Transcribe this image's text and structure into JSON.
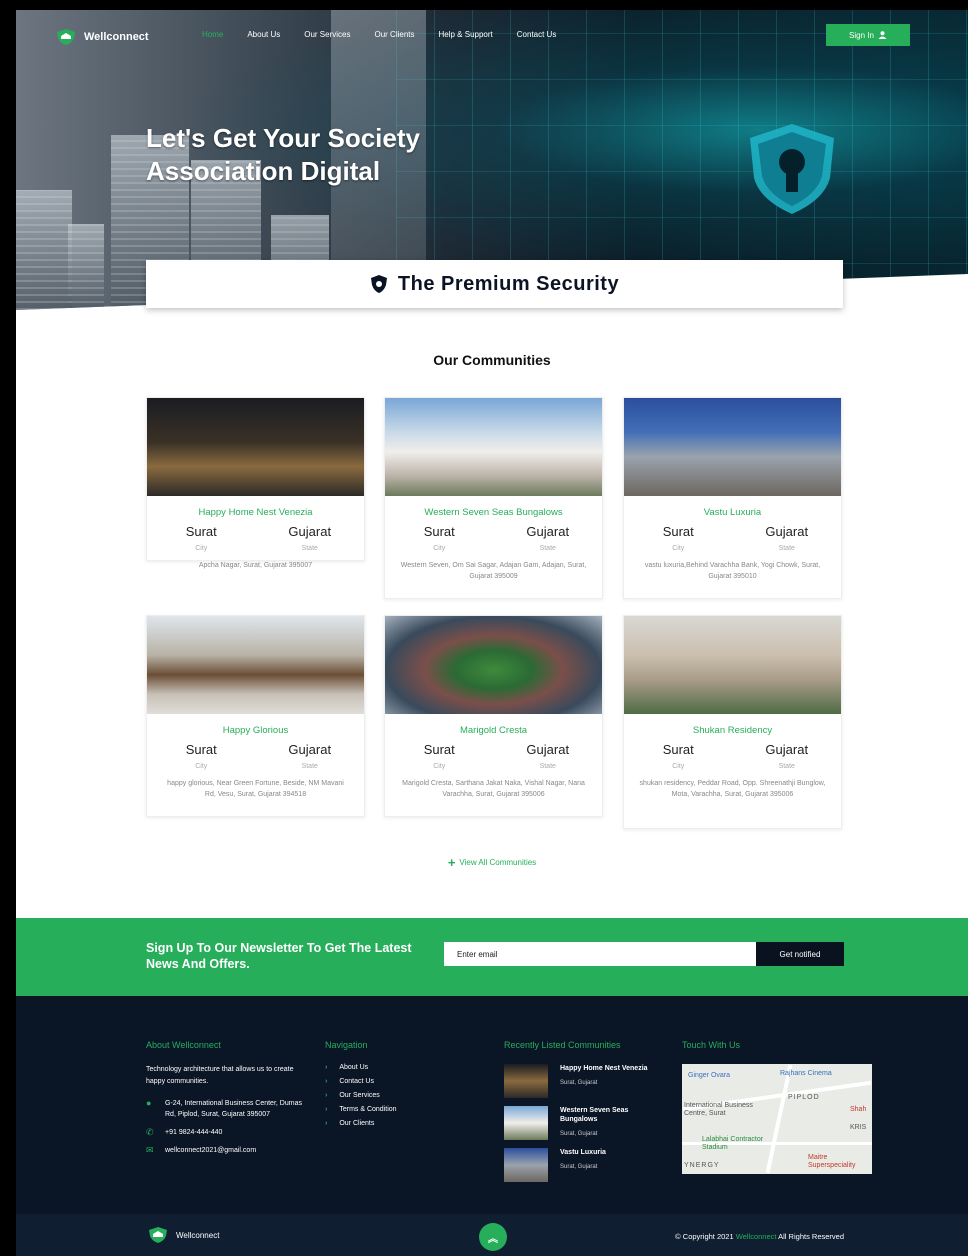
{
  "brand": {
    "name": "Wellconnect"
  },
  "nav": {
    "items": [
      {
        "label": "Home",
        "active": true
      },
      {
        "label": "About Us"
      },
      {
        "label": "Our Services"
      },
      {
        "label": "Our Clients"
      },
      {
        "label": "Help & Support"
      },
      {
        "label": "Contact Us"
      }
    ],
    "signin_label": "Sign In"
  },
  "hero": {
    "title_line1": "Let's Get Your Society",
    "title_line2": "Association Digital",
    "premium": "The Premium Security"
  },
  "communities": {
    "title": "Our Communities",
    "cards": [
      {
        "name": "Happy Home Nest Venezia",
        "city": "Surat",
        "state": "Gujarat",
        "city_label": "City",
        "state_label": "State",
        "address": "Apcha Nagar, Surat, Gujarat 395007"
      },
      {
        "name": "Western Seven Seas Bungalows",
        "city": "Surat",
        "state": "Gujarat",
        "city_label": "City",
        "state_label": "State",
        "address": "Western Seven, Om Sai Sagar, Adajan Gam, Adajan, Surat, Gujarat 395009"
      },
      {
        "name": "Vastu Luxuria",
        "city": "Surat",
        "state": "Gujarat",
        "city_label": "City",
        "state_label": "State",
        "address": "vastu luxuria,Behind Varachha Bank, Yogi Chowk, Surat, Gujarat 395010"
      },
      {
        "name": "Happy Glorious",
        "city": "Surat",
        "state": "Gujarat",
        "city_label": "City",
        "state_label": "State",
        "address": "happy glorious, Near Green Fortune, Beside, NM Mavani Rd, Vesu, Surat, Gujarat 394518"
      },
      {
        "name": "Marigold Cresta",
        "city": "Surat",
        "state": "Gujarat",
        "city_label": "City",
        "state_label": "State",
        "address": "Marigold Cresta, Sarthana Jakat Naka, Vishal Nagar, Nana Varachha, Surat, Gujarat 395006"
      },
      {
        "name": "Shukan Residency",
        "city": "Surat",
        "state": "Gujarat",
        "city_label": "City",
        "state_label": "State",
        "address": "shukan residency, Peddar Road, Opp. Shreenathji Bunglow, Mota, Varachha, Surat, Gujarat 395006"
      }
    ],
    "view_all": "View All Communities"
  },
  "newsletter": {
    "text": "Sign Up To Our Newsletter To Get The Latest News And Offers.",
    "placeholder": "Enter email",
    "button": "Get notified"
  },
  "footer": {
    "about": {
      "heading": "About Wellconnect",
      "text": "Technology architecture that allows us to create happy communities.",
      "address": "G-24, International Business Center, Dumas Rd, Piplod, Surat, Gujarat 395007",
      "phone": "+91 9824-444-440",
      "email": "wellconnect2021@gmail.com"
    },
    "navigation": {
      "heading": "Navigation",
      "links": [
        "About Us",
        "Contact Us",
        "Our Services",
        "Terms & Condition",
        "Our Clients"
      ]
    },
    "recent": {
      "heading": "Recently Listed Communities",
      "items": [
        {
          "name": "Happy Home Nest Venezia",
          "location": "Surat, Gujarat"
        },
        {
          "name": "Western Seven Seas Bungalows",
          "location": "Surat, Gujarat"
        },
        {
          "name": "Vastu Luxuria",
          "location": "Surat, Gujarat"
        }
      ]
    },
    "touch": {
      "heading": "Touch With Us",
      "map_labels": [
        "Ginger Ovara",
        "Rajhans Cinema",
        "PIPLOD",
        "International Business Centre, Surat",
        "Lalabhai Contractor Stadium",
        "KRIS",
        "Shah",
        "YNERGY",
        "Maitre Superspeciality"
      ]
    }
  },
  "bottom": {
    "brand": "Wellconnect",
    "copyright_prefix": "© Copyright 2021",
    "copyright_brand": "Wellconnect",
    "copyright_suffix": "All Rights Reserved"
  },
  "colors": {
    "accent": "#27ae5a",
    "footer_bg": "#0a1526",
    "bottom_bg": "#0f1e30"
  }
}
